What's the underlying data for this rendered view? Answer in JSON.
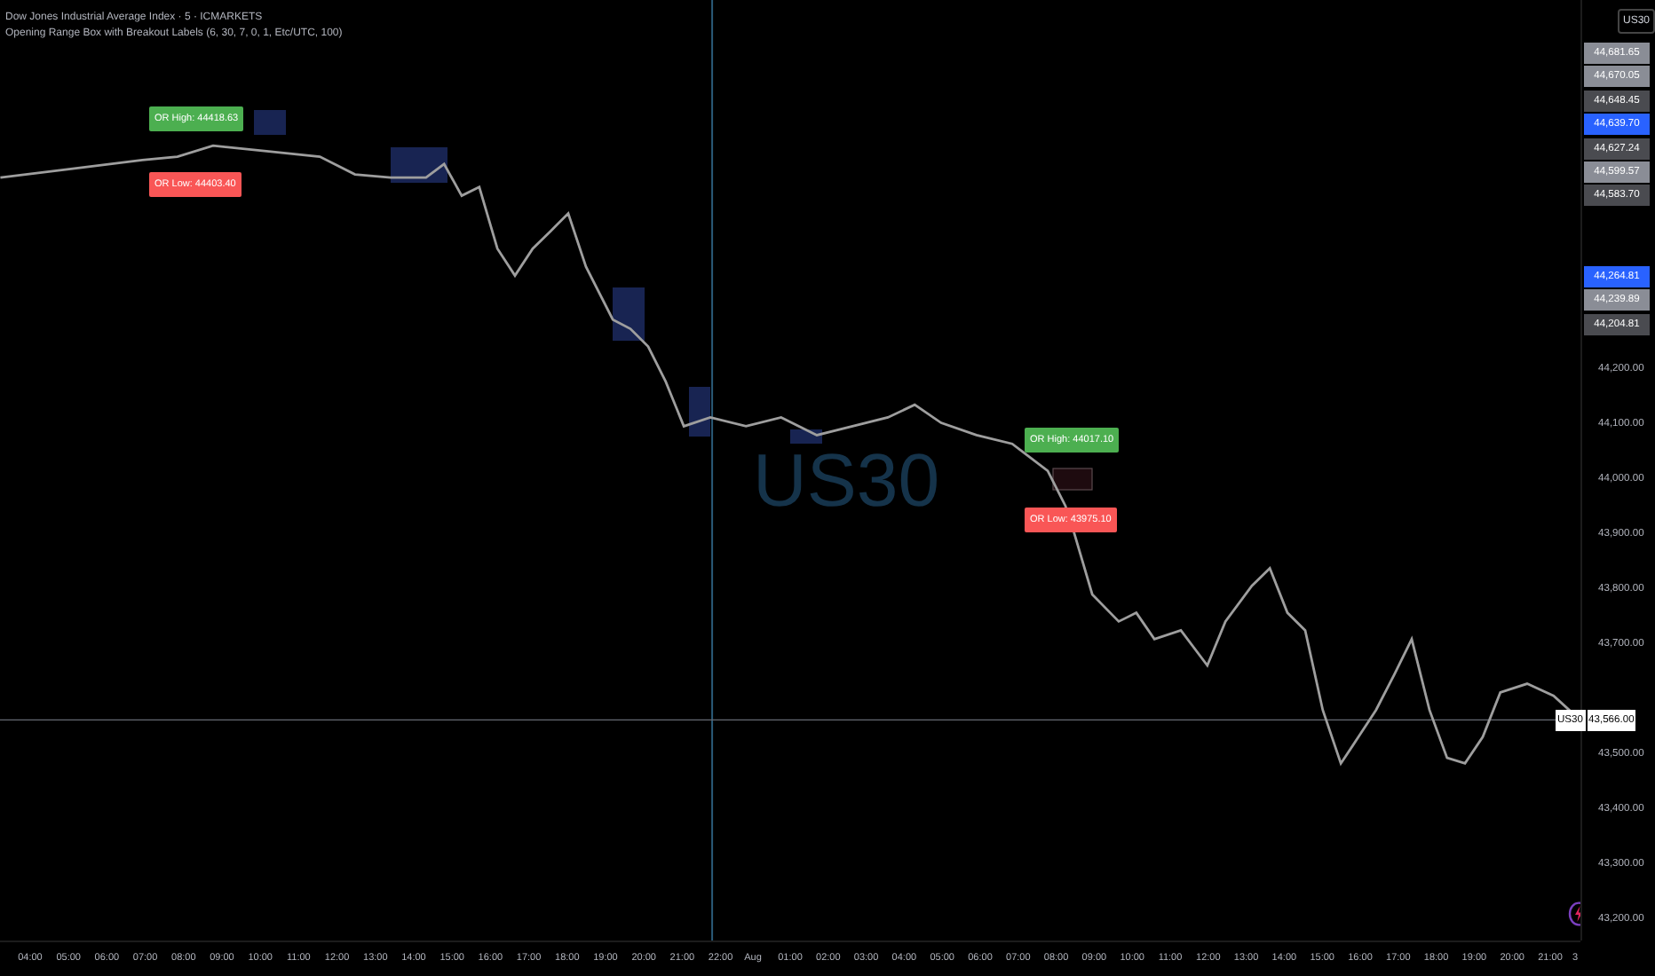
{
  "header": {
    "symbol_title": "Dow Jones Industrial Average Index · 5 · ICMARKETS",
    "indicator": "Opening Range Box with Breakout Labels (6, 30, 7, 0, 1, Etc/UTC, 100)"
  },
  "range_labels": [
    {
      "kind": "high",
      "text": "OR High: 44418.63"
    },
    {
      "kind": "low",
      "text": "OR Low: 44403.40"
    },
    {
      "kind": "high",
      "text": "OR High: 44017.10"
    },
    {
      "kind": "low",
      "text": "OR Low: 43975.10"
    }
  ],
  "watermark": "US30",
  "symbol_button": "US30",
  "price_tags": [
    {
      "text": "44,681.65",
      "color": "#8a8d96"
    },
    {
      "text": "44,670.05",
      "color": "#8a8d96"
    },
    {
      "text": "44,648.45",
      "color": "#4a4b50"
    },
    {
      "text": "44,639.70",
      "color": "#2962ff"
    },
    {
      "text": "44,627.24",
      "color": "#4a4b50"
    },
    {
      "text": "44,599.57",
      "color": "#8a8d96"
    },
    {
      "text": "44,583.70",
      "color": "#4a4b50"
    },
    {
      "text": "44,264.81",
      "color": "#2962ff"
    },
    {
      "text": "44,239.89",
      "color": "#8a8d96"
    },
    {
      "text": "44,204.81",
      "color": "#4a4b50"
    }
  ],
  "last_price": {
    "symbol": "US30",
    "price": "43,566.00"
  },
  "chart_data": {
    "type": "line",
    "xlim": [
      3.213,
      44.417
    ],
    "ylim": [
      43165,
      44875
    ],
    "ref_lines": [
      {
        "axis": "x",
        "value": 21.78,
        "color": "#2a5a78"
      },
      {
        "axis": "y",
        "value": 43566,
        "color": "#666a73"
      }
    ],
    "x": [
      3.22,
      5.06,
      6.92,
      7.84,
      8.77,
      10.16,
      11.55,
      12.47,
      13.4,
      14.32,
      14.79,
      15.25,
      15.71,
      16.18,
      16.64,
      17.1,
      17.57,
      18.03,
      18.49,
      19.19,
      19.65,
      20.11,
      20.57,
      21.04,
      21.73,
      22.66,
      23.58,
      24.51,
      25.44,
      26.36,
      27.06,
      27.75,
      28.67,
      29.6,
      30.53,
      30.99,
      31.22,
      31.69,
      32.38,
      32.84,
      33.31,
      34,
      34.69,
      35.16,
      35.85,
      36.32,
      36.78,
      37.24,
      37.7,
      38.17,
      38.63,
      39.09,
      39.56,
      40.02,
      40.48,
      40.94,
      41.41,
      41.87,
      42.33,
      43.03,
      43.72,
      44.41
    ],
    "series": [
      {
        "color": "#9e9e9e",
        "values": [
          44552,
          44568,
          44584,
          44590,
          44610,
          44600,
          44590,
          44558,
          44552,
          44552,
          44577,
          44519,
          44535,
          44423,
          44374,
          44423,
          44455,
          44487,
          44390,
          44294,
          44277,
          44245,
          44181,
          44100,
          44116,
          44100,
          44116,
          44084,
          44100,
          44116,
          44139,
          44106,
          44084,
          44068,
          44019,
          43955,
          43906,
          43794,
          43745,
          43761,
          43713,
          43729,
          43665,
          43745,
          43810,
          43842,
          43761,
          43729,
          43584,
          43487,
          43535,
          43584,
          43648,
          43713,
          43584,
          43497,
          43487,
          43535,
          43616,
          43632,
          43610,
          43566
        ]
      }
    ],
    "yticks": [
      {
        "value": 44200,
        "label": "44,200.00"
      },
      {
        "value": 44100,
        "label": "44,100.00"
      },
      {
        "value": 44000,
        "label": "44,000.00"
      },
      {
        "value": 43900,
        "label": "43,900.00"
      },
      {
        "value": 43800,
        "label": "43,800.00"
      },
      {
        "value": 43700,
        "label": "43,700.00"
      },
      {
        "value": 43500,
        "label": "43,500.00"
      },
      {
        "value": 43400,
        "label": "43,400.00"
      },
      {
        "value": 43300,
        "label": "43,300.00"
      },
      {
        "value": 43200,
        "label": "43,200.00"
      }
    ],
    "xticks": [
      {
        "value": 4,
        "label": "04:00"
      },
      {
        "value": 5,
        "label": "05:00"
      },
      {
        "value": 6,
        "label": "06:00"
      },
      {
        "value": 7,
        "label": "07:00"
      },
      {
        "value": 8,
        "label": "08:00"
      },
      {
        "value": 9,
        "label": "09:00"
      },
      {
        "value": 10,
        "label": "10:00"
      },
      {
        "value": 11,
        "label": "11:00"
      },
      {
        "value": 12,
        "label": "12:00"
      },
      {
        "value": 13,
        "label": "13:00"
      },
      {
        "value": 14,
        "label": "14:00"
      },
      {
        "value": 15,
        "label": "15:00"
      },
      {
        "value": 16,
        "label": "16:00"
      },
      {
        "value": 17,
        "label": "17:00"
      },
      {
        "value": 18,
        "label": "18:00"
      },
      {
        "value": 19,
        "label": "19:00"
      },
      {
        "value": 20,
        "label": "20:00"
      },
      {
        "value": 21,
        "label": "21:00"
      },
      {
        "value": 22,
        "label": "22:00"
      }
    ]
  },
  "time_axis": [
    "Aug",
    "01:00",
    "02:00",
    "03:00",
    "04:00",
    "05:00",
    "06:00",
    "07:00",
    "08:00",
    "09:00",
    "10:00",
    "11:00",
    "12:00",
    "13:00",
    "14:00",
    "15:00",
    "16:00",
    "17:00",
    "18:00",
    "19:00",
    "20:00",
    "21:00",
    "3"
  ]
}
